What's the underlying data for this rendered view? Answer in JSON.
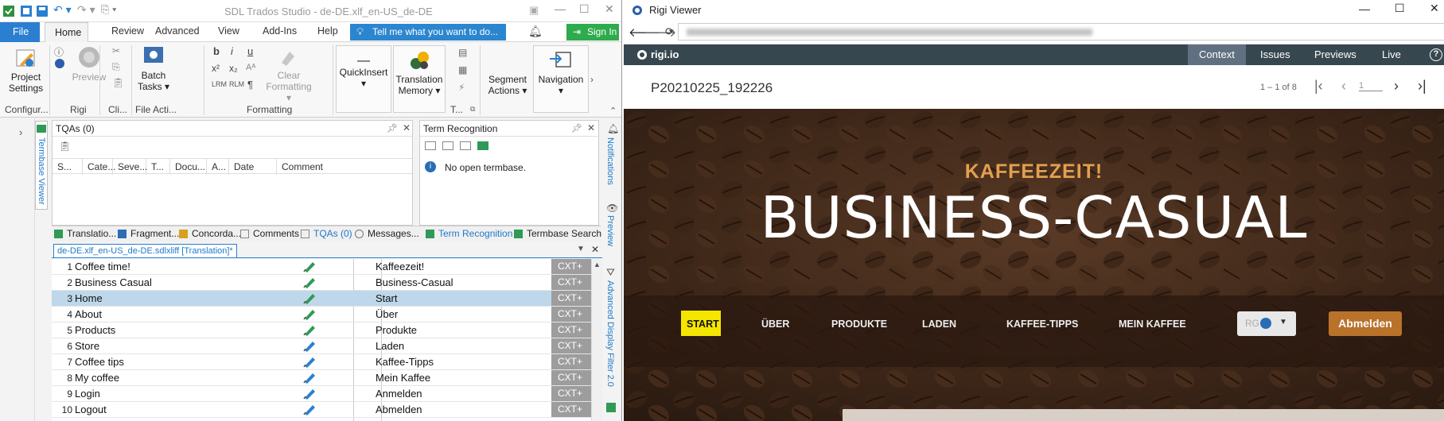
{
  "trados": {
    "title": "SDL Trados Studio - de-DE.xlf_en-US_de-DE",
    "tabs": {
      "file": "File",
      "home": "Home",
      "review": "Review",
      "advanced": "Advanced",
      "view": "View",
      "addins": "Add-Ins",
      "help": "Help"
    },
    "tell_me": "Tell me what you want to do...",
    "sign_in": "Sign In",
    "ribbon": {
      "project_settings": [
        "Project",
        "Settings"
      ],
      "preview": "Preview",
      "batch_tasks": [
        "Batch",
        "Tasks"
      ],
      "clear_formatting": [
        "Clear",
        "Formatting"
      ],
      "quickinsert": "QuickInsert",
      "translation_memory": [
        "Translation",
        "Memory"
      ],
      "segment_actions": [
        "Segment",
        "Actions"
      ],
      "navigation": "Navigation",
      "groups": {
        "configure": "Configur...",
        "rigi": "Rigi",
        "clipboard": "Cli...",
        "file_actions": "File Acti...",
        "formatting": "Formatting",
        "t": "T..."
      }
    },
    "side_labels": {
      "termbase_viewer": "Termbase Viewer",
      "notifications": "Notifications",
      "preview": "Preview",
      "adv_filter": "Advanced Display Filter 2.0"
    },
    "tqa": {
      "title": "TQAs (0)",
      "columns": [
        "S...",
        "Cate...",
        "Seve...",
        "T...",
        "Docu...",
        "A...",
        "Date",
        "Comment"
      ]
    },
    "term_recognition": {
      "title": "Term Recognition",
      "message": "No open termbase."
    },
    "bottom_tabs": [
      "Translatio...",
      "Fragment...",
      "Concorda...",
      "Comments",
      "TQAs (0)",
      "Messages...",
      "Term Recognition",
      "Termbase Search"
    ],
    "doc_tab": "de-DE.xlf_en-US_de-DE.sdlxliff [Translation]*",
    "segments": [
      {
        "n": "1",
        "src": "Coffee time!",
        "tgt": "Kaffeezeit!",
        "cxt": "CXT+"
      },
      {
        "n": "2",
        "src": "Business Casual",
        "tgt": "Business-Casual",
        "cxt": "CXT+"
      },
      {
        "n": "3",
        "src": "Home",
        "tgt": "Start",
        "cxt": "CXT+"
      },
      {
        "n": "4",
        "src": "About",
        "tgt": "Über",
        "cxt": "CXT+"
      },
      {
        "n": "5",
        "src": "Products",
        "tgt": "Produkte",
        "cxt": "CXT+"
      },
      {
        "n": "6",
        "src": "Store",
        "tgt": "Laden",
        "cxt": "CXT+"
      },
      {
        "n": "7",
        "src": "Coffee tips",
        "tgt": "Kaffee-Tipps",
        "cxt": "CXT+"
      },
      {
        "n": "8",
        "src": "My coffee",
        "tgt": "Mein Kaffee",
        "cxt": "CXT+"
      },
      {
        "n": "9",
        "src": "Login",
        "tgt": "Anmelden",
        "cxt": "CXT+"
      },
      {
        "n": "10",
        "src": "Logout",
        "tgt": "Abmelden",
        "cxt": "CXT+"
      }
    ]
  },
  "rigi": {
    "window_title": "Rigi Viewer",
    "logo": "rigi.io",
    "nav": [
      "Context",
      "Issues",
      "Previews",
      "Live"
    ],
    "snapshot": "P20210225_192226",
    "pager": "1 – 1 of 8",
    "page_input": "1",
    "hero": {
      "kicker": "KAFFEEZEIT!",
      "headline": "BUSINESS-CASUAL",
      "menu": [
        "START",
        "ÜBER",
        "PRODUKTE",
        "LADEN",
        "KAFFEE-TIPPS",
        "MEIN KAFFEE"
      ],
      "lang_button": "RG",
      "logout": "Abmelden"
    }
  },
  "colors": {
    "accent": "#2b7fd0",
    "signin": "#2eab4c",
    "rigi_nav": "#37474f",
    "hero_gold": "#e2a04f",
    "start_yellow": "#f5e600",
    "logout_btn": "#b9722a"
  }
}
